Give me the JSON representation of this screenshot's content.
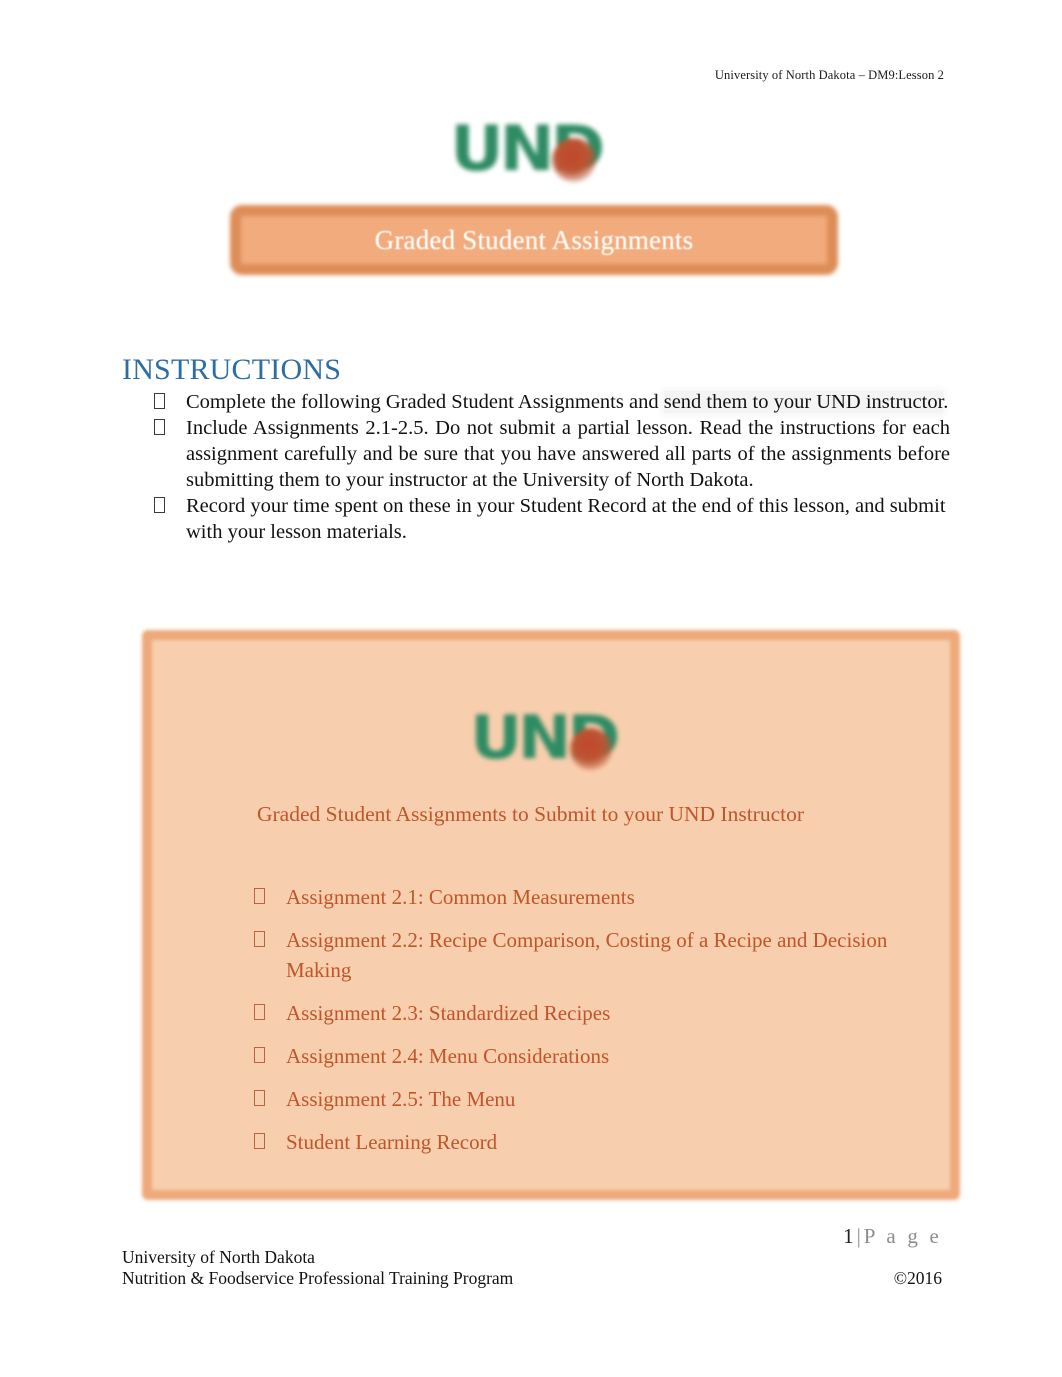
{
  "header": {
    "running_head": "University of North Dakota – DM9:Lesson 2"
  },
  "logo": {
    "text": "UND",
    "alt": "und-logo",
    "green_hex": "#2e8b63",
    "flame_hex": "#bb5533"
  },
  "title_banner": {
    "text": "Graded Student Assignments",
    "fill_hex": "#f2ab7c",
    "border_hex": "#dd8d57",
    "text_hex": "#ffffff"
  },
  "instructions": {
    "heading": "INSTRUCTIONS",
    "heading_hex": "#2e6da4",
    "bullet_glyph": "",
    "items": [
      {
        "pre": "Complete the following Graded Student Assignments and ",
        "highlight": "send them to your UND instructor",
        "post": "."
      },
      {
        "pre": "Include Assignments 2.1-2.5.  Do not submit a partial lesson.   Read the instructions for each assignment carefully and be sure that you have answered all parts of the assignments before submitting them to your instructor at the University of North Dakota.",
        "highlight": "",
        "post": ""
      },
      {
        "pre": "Record your time spent on these in your  Student Record  at the end of this lesson, and submit with your lesson materials.",
        "highlight": "",
        "post": ""
      }
    ]
  },
  "assignments_box": {
    "fill_hex": "#f8cfae",
    "border_hex": "#eda979",
    "text_hex": "#c0552a",
    "heading": "Graded Student Assignments to Submit to your UND Instructor",
    "bullet_glyph": "",
    "items": [
      "Assignment 2.1:  Common Measurements",
      "Assignment 2.2:  Recipe Comparison, Costing of a Recipe and Decision Making",
      "Assignment 2.3:  Standardized Recipes",
      "Assignment 2.4:  Menu Considerations",
      "Assignment 2.5:  The Menu",
      "Student Learning Record"
    ]
  },
  "footer": {
    "page_number": "1",
    "page_separator": "|",
    "page_word": "P a g e",
    "org_line1": "University of North Dakota",
    "org_line2": "Nutrition & Foodservice Professional Training Program",
    "copyright": "©2016"
  }
}
